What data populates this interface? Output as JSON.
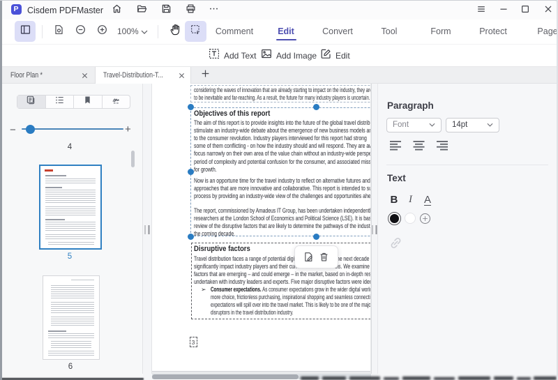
{
  "window": {
    "title": "Cisdem PDFMaster",
    "title_initial": "P"
  },
  "titlebar": {
    "icons": [
      "home",
      "open-folder",
      "save",
      "print",
      "more"
    ],
    "window_controls": [
      "menu",
      "minimize",
      "maximize",
      "close"
    ]
  },
  "toolbar": {
    "zoom_level": "100%",
    "tabs": [
      {
        "label": "Comment"
      },
      {
        "label": "Edit",
        "active": true
      },
      {
        "label": "Convert"
      },
      {
        "label": "Tool"
      },
      {
        "label": "Form"
      },
      {
        "label": "Protect"
      },
      {
        "label": "Page"
      }
    ]
  },
  "subtoolbar": {
    "actions": [
      {
        "label": "Add Text",
        "icon": "add-text"
      },
      {
        "label": "Add Image",
        "icon": "add-image"
      },
      {
        "label": "Edit",
        "icon": "edit"
      }
    ]
  },
  "doc_tabs": {
    "tabs": [
      {
        "label": "Floor Plan *",
        "modified": true
      },
      {
        "label": "Travel-Distribution-T...",
        "active": true
      }
    ]
  },
  "sidebar": {
    "view_modes": [
      "thumbnails",
      "outline",
      "bookmarks",
      "signature"
    ],
    "active_view_mode": "thumbnails",
    "page_above_label": "4",
    "thumbnails": [
      {
        "page": "5",
        "selected": true
      },
      {
        "page": "6",
        "selected": false
      }
    ],
    "slider_minus": "−",
    "slider_plus": "+"
  },
  "right_panel": {
    "paragraph_section": {
      "title": "Paragraph",
      "font_placeholder": "Font",
      "font_size_value": "14pt",
      "alignments": [
        "align-left",
        "align-center",
        "align-right"
      ]
    },
    "text_section": {
      "title": "Text",
      "bold": "B",
      "italic": "I",
      "underline": "A",
      "colors": [
        "black-selected",
        "white",
        "add-color"
      ]
    }
  },
  "document": {
    "intro": {
      "lines": [
        "considering the waves of innovation that are already starting to impact on the industry, they are likely",
        "to be inevitable and far-reaching. As a result, the future for many industry players is uncertain."
      ]
    },
    "heading1": "Objectives of this report",
    "para1": {
      "lines": [
        "The aim of this report is to provide insights into the future of the global travel distribution",
        "stimulate an industry-wide debate about the emergence of new business models and",
        "to the consumer revolution. Industry players interviewed for this report had strong",
        "some of them conflicting - on how the industry should and will respond. They are aware",
        "focus narrowly on their own area of the value chain without an industry-wide perspective:",
        "period of complexity and potential confusion for the consumer, and associated missed",
        "for growth."
      ]
    },
    "para2": {
      "lines": [
        "Now is an opportune time for the travel industry to reflect on alternative futures and to",
        "approaches that are more innovative and collaborative. This report is  intended to support",
        "process by providing an industry-wide view of the challenges and opportunities ahead."
      ]
    },
    "para3": {
      "lines": [
        "The report, commissioned by Amadeus IT Group, has been undertaken  independently by",
        "researchers at the London School of Economics and Political Science (LSE). It is based on",
        "review of the disruptive factors that are likely to determine the pathways of the industry",
        "the coming decade."
      ]
    },
    "heading2": "Disruptive factors",
    "para4": {
      "lines": [
        "Travel distribution faces a range of potential digital disruptions over the next decade",
        "significantly impact industry players and their current business models. We examine five",
        "factors that are emerging – and could emerge – in the market, based on in-depth research",
        "undertaken with industry leaders and experts. Five major disruptive factors were identified:"
      ]
    },
    "bullet": {
      "marker": "➢",
      "bold": "Consumer expectations.",
      "first_rest": " As consumer expectations grow in the wider digital world - e.g.",
      "lines": [
        "more choice, frictionless purchasing, inspirational shopping and seamless connectivity -",
        "expectations will spill over into the travel market. This is likely to be one of the major",
        "disruptors in the travel distribution industry."
      ]
    },
    "page_number": "3"
  },
  "colors": {
    "accent_purple": "#4c4db0",
    "selection_blue": "#2a7cc2",
    "active_button_lavender": "#dcdef7"
  }
}
